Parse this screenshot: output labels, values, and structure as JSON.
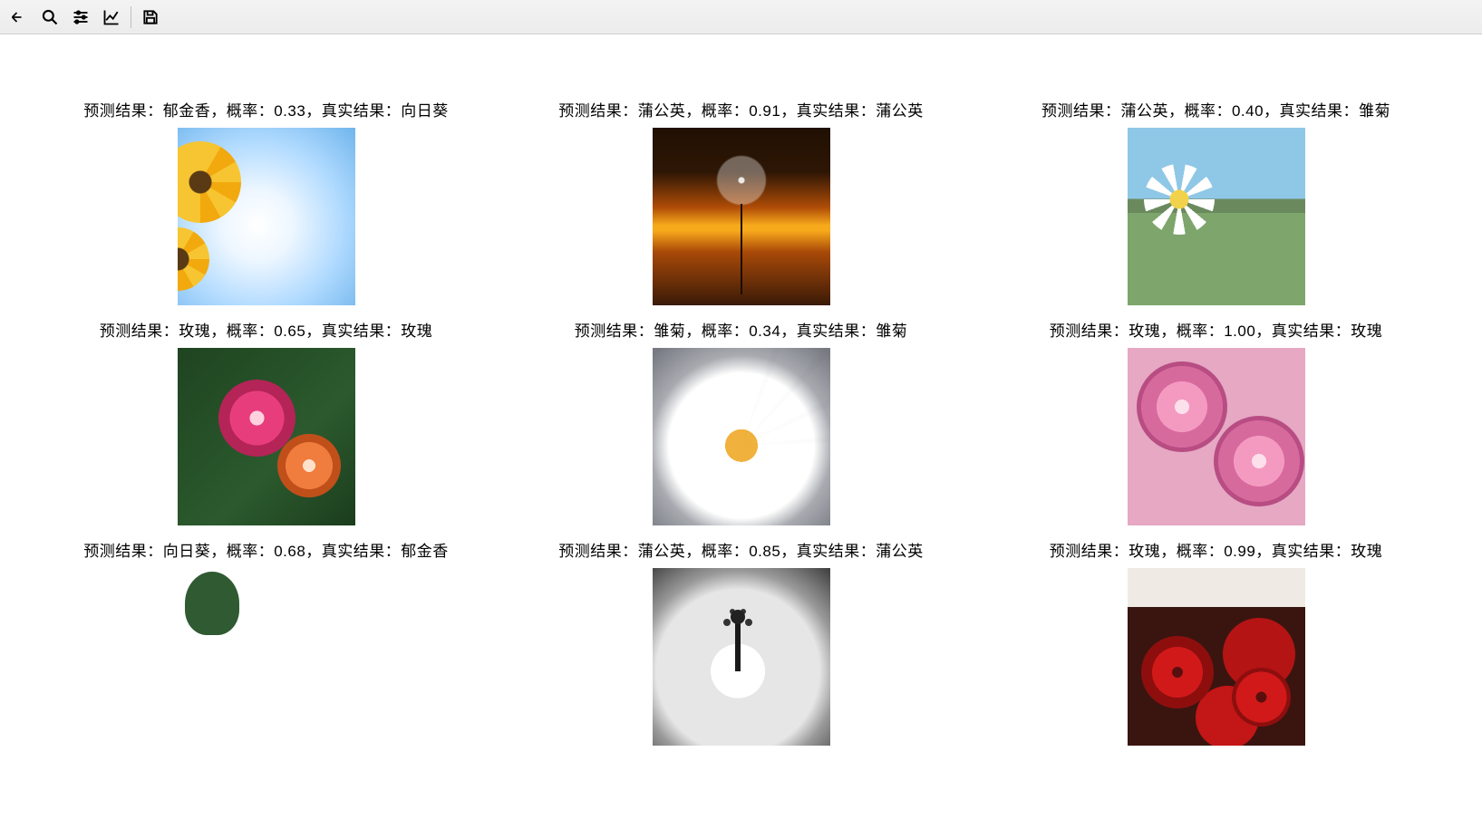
{
  "toolbar": {
    "icons": [
      "pan",
      "zoom",
      "sliders",
      "chart",
      "save"
    ]
  },
  "label_prefix": "预测结果：",
  "prob_prefix": "，概率：",
  "truth_prefix": "，真实结果：",
  "grid": [
    [
      {
        "pred": "郁金香",
        "prob": "0.33",
        "truth": "向日葵",
        "imgClass": "sunflower-sky"
      },
      {
        "pred": "蒲公英",
        "prob": "0.91",
        "truth": "蒲公英",
        "imgClass": "dandelion-sunset"
      },
      {
        "pred": "蒲公英",
        "prob": "0.40",
        "truth": "雏菊",
        "imgClass": "daisy-mountain"
      }
    ],
    [
      {
        "pred": "玫瑰",
        "prob": "0.65",
        "truth": "玫瑰",
        "imgClass": "roses-garden"
      },
      {
        "pred": "雏菊",
        "prob": "0.34",
        "truth": "雏菊",
        "imgClass": "daisy-white"
      },
      {
        "pred": "玫瑰",
        "prob": "1.00",
        "truth": "玫瑰",
        "imgClass": "pink-roses"
      }
    ],
    [
      {
        "pred": "向日葵",
        "prob": "0.68",
        "truth": "郁金香",
        "imgClass": "tulip-park"
      },
      {
        "pred": "蒲公英",
        "prob": "0.85",
        "truth": "蒲公英",
        "imgClass": "dandelion-bw"
      },
      {
        "pred": "玫瑰",
        "prob": "0.99",
        "truth": "玫瑰",
        "imgClass": "red-roses"
      }
    ]
  ]
}
